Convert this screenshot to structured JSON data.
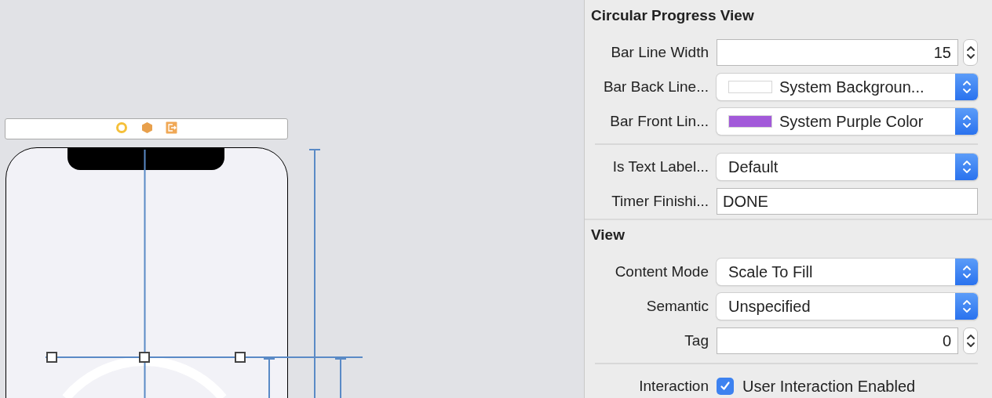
{
  "inspector": {
    "sections": [
      {
        "title": "Circular Progress View",
        "groups": [
          [
            {
              "kind": "stepper",
              "label": "Bar Line Width",
              "value": "15"
            },
            {
              "kind": "color",
              "label": "Bar Back Line...",
              "value": "System Backgroun...",
              "color": "#ffffff"
            },
            {
              "kind": "color",
              "label": "Bar Front Lin...",
              "value": "System Purple Color",
              "color": "#a259d9"
            }
          ],
          [
            {
              "kind": "popup",
              "label": "Is Text Label...",
              "value": "Default"
            },
            {
              "kind": "text",
              "label": "Timer Finishi...",
              "value": "DONE"
            }
          ]
        ]
      },
      {
        "title": "View",
        "groups": [
          [
            {
              "kind": "popup",
              "label": "Content Mode",
              "value": "Scale To Fill"
            },
            {
              "kind": "popup",
              "label": "Semantic",
              "value": "Unspecified"
            },
            {
              "kind": "stepper",
              "label": "Tag",
              "value": "0"
            }
          ],
          [
            {
              "kind": "checkbox",
              "label": "Interaction",
              "value": "User Interaction Enabled",
              "checked": true
            }
          ]
        ]
      }
    ]
  }
}
